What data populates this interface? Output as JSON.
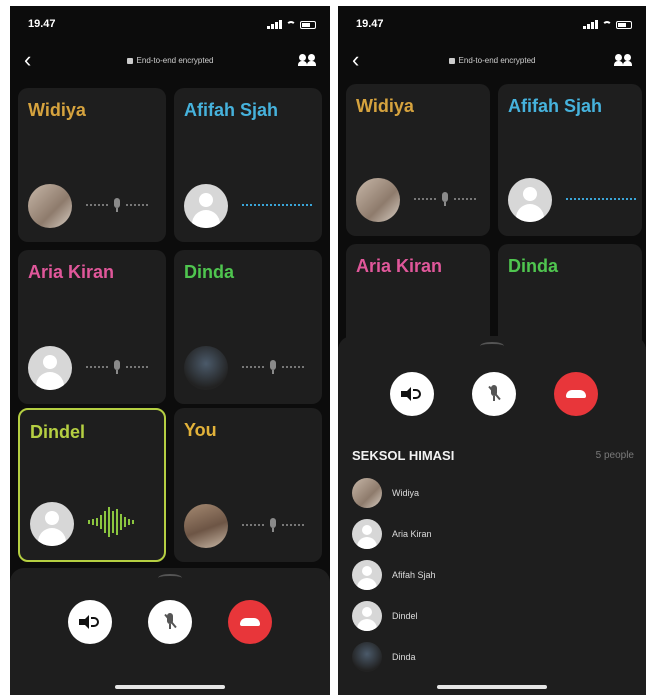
{
  "status": {
    "time": "19.47"
  },
  "header": {
    "encryption_label": "End-to-end encrypted"
  },
  "colors": {
    "widiya": "#d6a33e",
    "afifah": "#46b2dc",
    "aria": "#e0579a",
    "dinda": "#4fc54f",
    "dindel": "#b5cf42",
    "you": "#e2b23a",
    "end_call": "#e8363a"
  },
  "left_tiles": [
    {
      "name": "Widiya",
      "color": "#d6a33e"
    },
    {
      "name": "Afifah Sjah",
      "color": "#46b2dc"
    },
    {
      "name": "Aria Kiran",
      "color": "#e0579a"
    },
    {
      "name": "Dinda",
      "color": "#4fc54f"
    },
    {
      "name": "Dindel",
      "color": "#b5cf42"
    },
    {
      "name": "You",
      "color": "#e2b23a"
    }
  ],
  "right_tiles": [
    {
      "name": "Widiya"
    },
    {
      "name": "Afifah Sjah"
    },
    {
      "name": "Aria Kiran"
    },
    {
      "name": "Dinda"
    }
  ],
  "group": {
    "title": "SEKSOL HIMASI",
    "count": "5 people"
  },
  "participants": [
    {
      "name": "Widiya"
    },
    {
      "name": "Aria Kiran"
    },
    {
      "name": "Afifah Sjah"
    },
    {
      "name": "Dindel"
    },
    {
      "name": "Dinda"
    }
  ],
  "icons": [
    "back-chevron-icon",
    "lock-icon",
    "people-icon",
    "mic-icon",
    "speaker-icon",
    "mic-off-icon",
    "end-call-icon",
    "avatar-placeholder-icon"
  ]
}
